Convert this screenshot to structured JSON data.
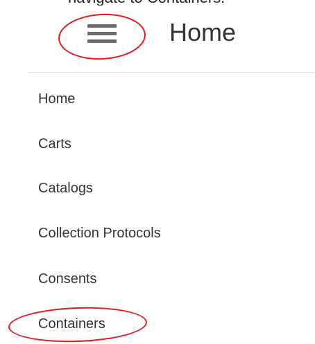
{
  "caption": "navigate to Containers.",
  "header": {
    "menu_icon": "hamburger-menu-icon",
    "title": "Home"
  },
  "nav": {
    "items": [
      {
        "label": "Home"
      },
      {
        "label": "Carts"
      },
      {
        "label": "Catalogs"
      },
      {
        "label": "Collection Protocols"
      },
      {
        "label": "Consents"
      },
      {
        "label": "Containers"
      }
    ]
  },
  "annotations": {
    "color": "#e3161b",
    "targets": [
      "menu-button",
      "nav-item-containers"
    ]
  },
  "colors": {
    "text": "#333333",
    "icon": "#6b6b6b",
    "divider": "#e4e4e4"
  }
}
